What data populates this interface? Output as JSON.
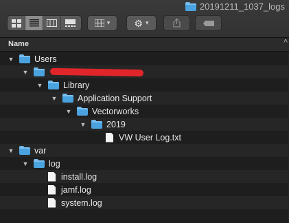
{
  "window": {
    "title": "20191211_1037_logs"
  },
  "toolbar": {
    "view_modes": [
      "icon-view",
      "list-view",
      "column-view",
      "gallery-view"
    ],
    "active_view": "list-view",
    "group_menu": "grid-icon",
    "action_menu": "gear-icon",
    "share": "share-icon",
    "tag": "tag-icon"
  },
  "header": {
    "name_col": "Name"
  },
  "tree": [
    {
      "label": "Users",
      "type": "folder",
      "depth": 0,
      "expanded": true
    },
    {
      "label": "",
      "type": "folder",
      "depth": 1,
      "expanded": true,
      "redacted": true
    },
    {
      "label": "Library",
      "type": "folder",
      "depth": 2,
      "expanded": true
    },
    {
      "label": "Application Support",
      "type": "folder",
      "depth": 3,
      "expanded": true
    },
    {
      "label": "Vectorworks",
      "type": "folder",
      "depth": 4,
      "expanded": true
    },
    {
      "label": "2019",
      "type": "folder",
      "depth": 5,
      "expanded": true
    },
    {
      "label": "VW User Log.txt",
      "type": "file",
      "depth": 6
    },
    {
      "label": "var",
      "type": "folder",
      "depth": 0,
      "expanded": true
    },
    {
      "label": "log",
      "type": "folder",
      "depth": 1,
      "expanded": true
    },
    {
      "label": "install.log",
      "type": "file",
      "depth": 2
    },
    {
      "label": "jamf.log",
      "type": "file",
      "depth": 2
    },
    {
      "label": "system.log",
      "type": "file",
      "depth": 2
    }
  ],
  "colors": {
    "folder": "#4aa3df",
    "redaction": "#e0262a",
    "background": "#1e1e1e"
  }
}
